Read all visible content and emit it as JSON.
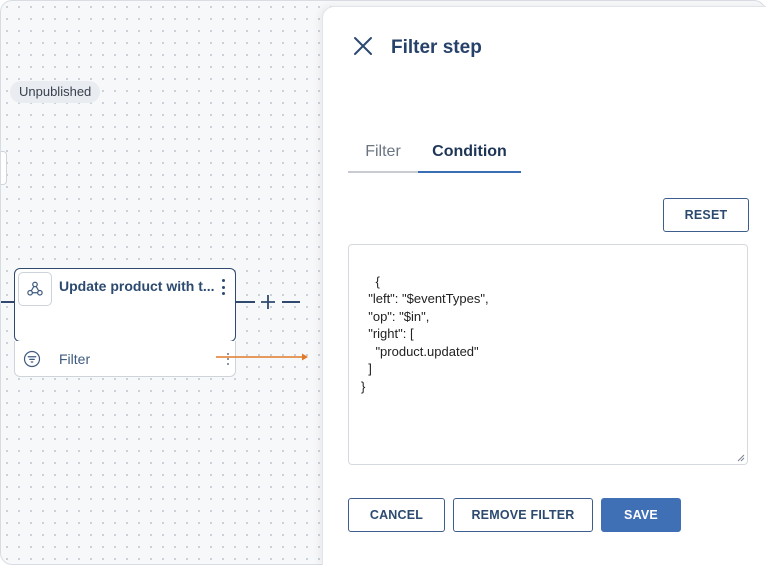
{
  "canvas": {
    "status_badge": "Unpublished",
    "node": {
      "title": "Update product with t...",
      "icon": "webhook-icon"
    },
    "filter_row": {
      "label": "Filter",
      "icon": "filter-icon"
    }
  },
  "panel": {
    "title": "Filter step",
    "tabs": [
      {
        "label": "Filter",
        "active": false
      },
      {
        "label": "Condition",
        "active": true
      }
    ],
    "reset_label": "RESET",
    "condition_json": "{\n  \"left\": \"$eventTypes\",\n  \"op\": \"$in\",\n  \"right\": [\n    \"product.updated\"\n  ]\n}",
    "buttons": {
      "cancel": "CANCEL",
      "remove_filter": "REMOVE FILTER",
      "save": "SAVE"
    }
  },
  "colors": {
    "accent": "#3f6fb5",
    "title": "#27426a",
    "node_border": "#2f4a6e",
    "connector_arrow": "#e07a2b"
  }
}
